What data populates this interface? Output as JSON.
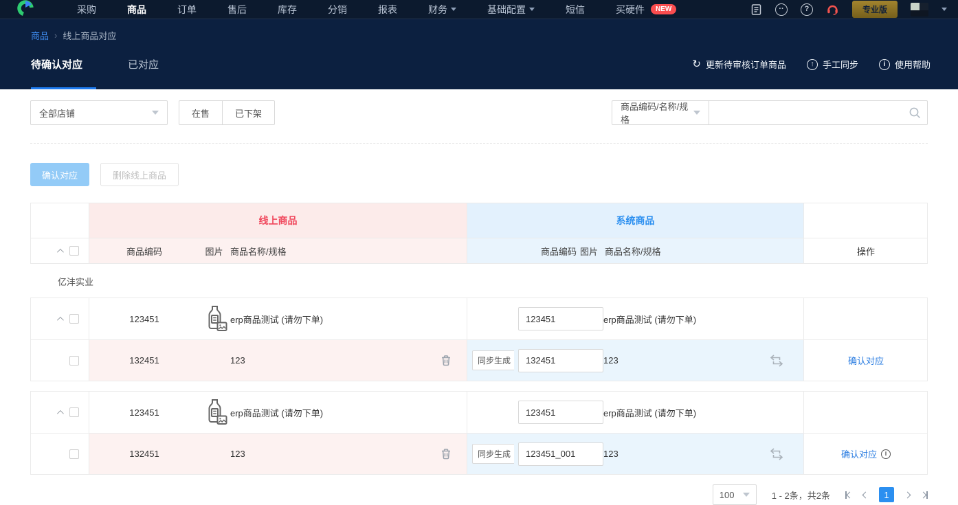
{
  "navbar": {
    "items": [
      {
        "label": "采购"
      },
      {
        "label": "商品"
      },
      {
        "label": "订单"
      },
      {
        "label": "售后"
      },
      {
        "label": "库存"
      },
      {
        "label": "分销"
      },
      {
        "label": "报表"
      },
      {
        "label": "财务"
      },
      {
        "label": "基础配置"
      },
      {
        "label": "短信"
      },
      {
        "label": "买硬件"
      }
    ],
    "new_badge": "NEW",
    "pro_button": "专业版"
  },
  "icons": {
    "refresh": "↻",
    "sync_up": "↑",
    "info": "i",
    "chat": "··",
    "question": "?"
  },
  "breadcrumb": {
    "section": "商品",
    "separator": "›",
    "current": "线上商品对应"
  },
  "tabs": {
    "pending": "待确认对应",
    "matched": "已对应"
  },
  "toolbar": {
    "update_label": "更新待审核订单商品",
    "sync_label": "手工同步",
    "help_label": "使用帮助"
  },
  "filters": {
    "shop": "全部店铺",
    "on_sale": "在售",
    "off_shelf": "已下架",
    "search_type": "商品编码/名称/规格",
    "search_value": "",
    "search_placeholder": ""
  },
  "bulk_actions": {
    "confirm": "确认对应",
    "delete": "删除线上商品"
  },
  "table": {
    "online_header": "线上商品",
    "system_header": "系统商品",
    "action_header": "操作",
    "cols": {
      "code": "商品编码",
      "image": "图片",
      "name": "商品名称/规格"
    },
    "shop": "亿沣实业",
    "sync_generate": "同步生成",
    "confirm_link": "确认对应",
    "blocks": [
      {
        "main": {
          "online_code": "123451",
          "online_name": "erp商品测试 (请勿下单)",
          "system_code": "123451",
          "system_name": "erp商品测试 (请勿下单)"
        },
        "sub": {
          "online_code": "132451",
          "online_name": "123",
          "system_code": "132451",
          "system_name": "123"
        }
      },
      {
        "main": {
          "online_code": "123451",
          "online_name": "erp商品测试 (请勿下单)",
          "system_code": "123451",
          "system_name": "erp商品测试 (请勿下单)"
        },
        "sub": {
          "online_code": "132451",
          "online_name": "123",
          "system_code": "123451_001",
          "system_name": "123"
        }
      }
    ]
  },
  "pagination": {
    "page_size": "100",
    "summary": "1 - 2条，共2条",
    "page": "1"
  }
}
